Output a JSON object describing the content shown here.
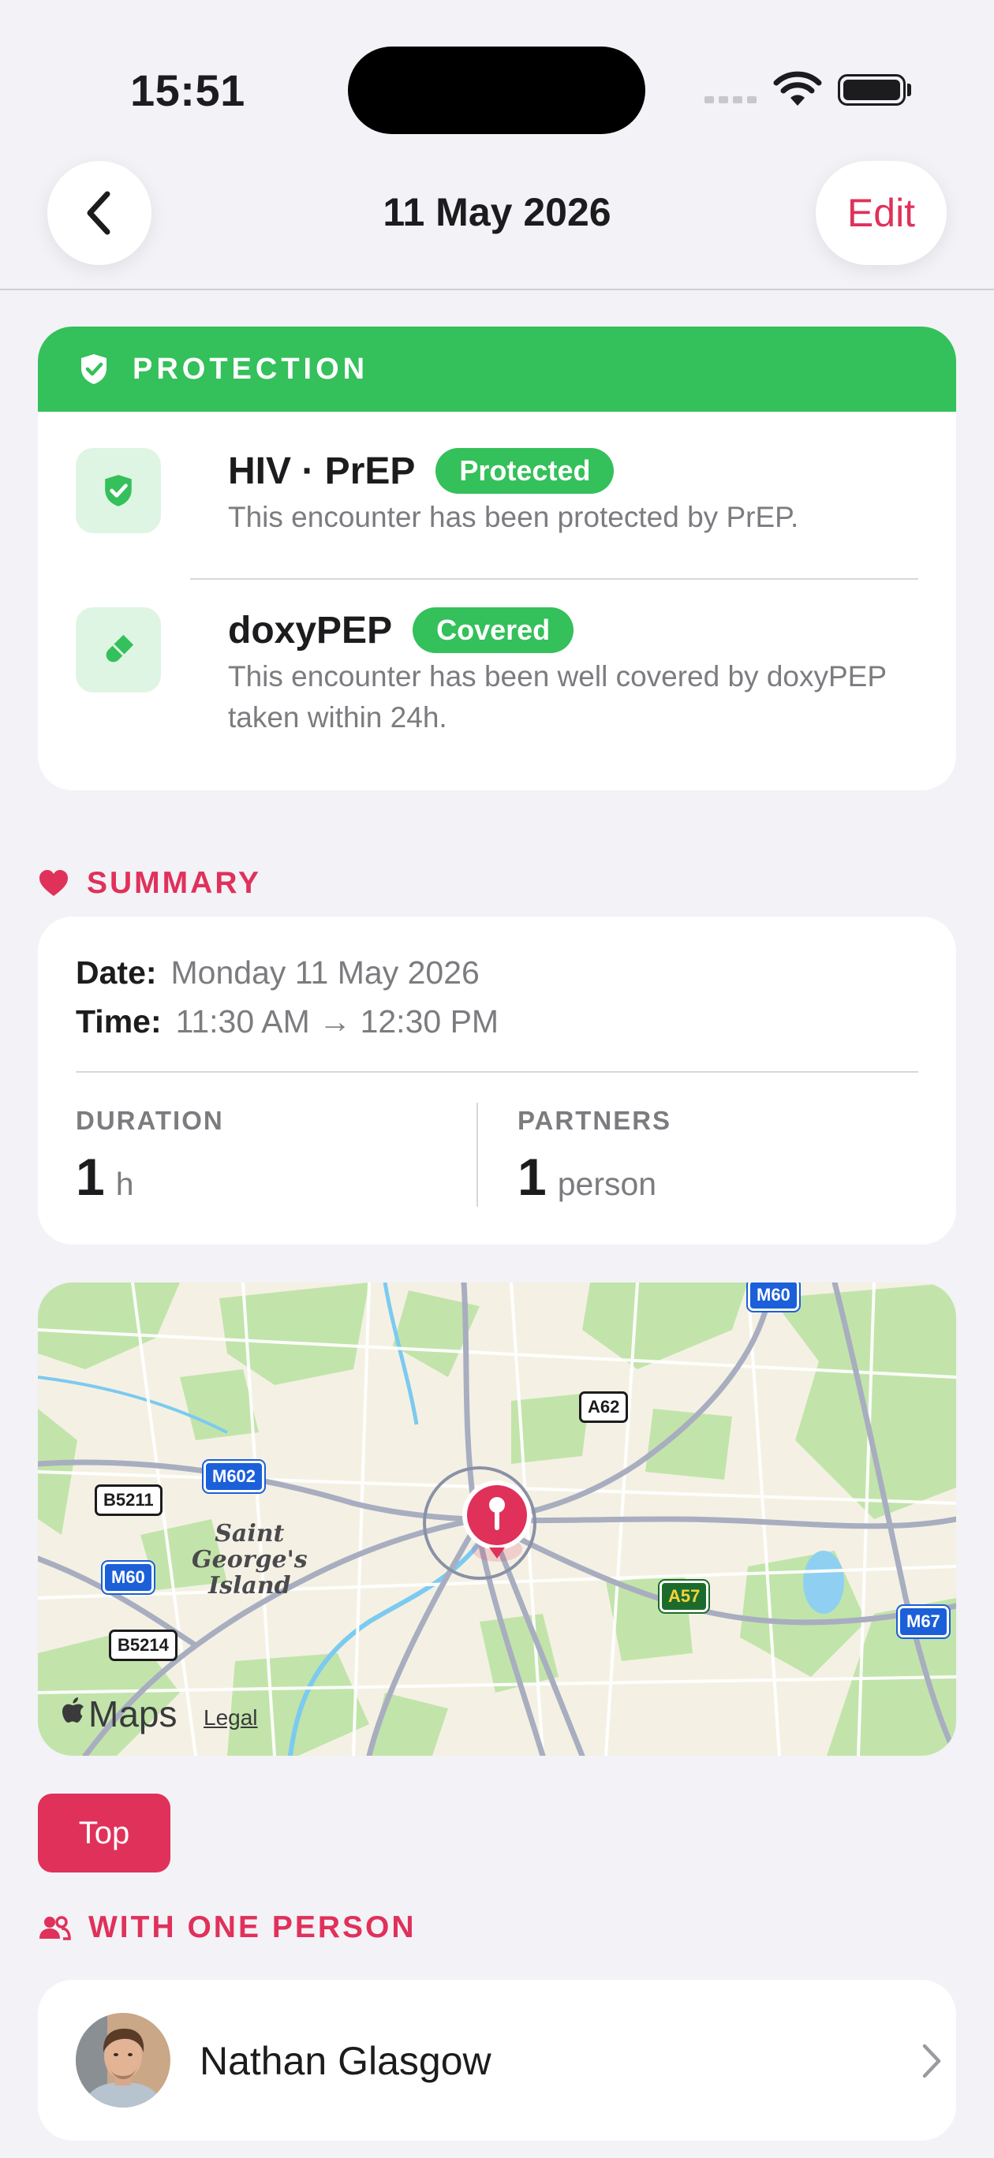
{
  "status_bar": {
    "time": "15:51"
  },
  "nav": {
    "title": "11 May 2026",
    "edit_label": "Edit"
  },
  "protection": {
    "header": "PROTECTION",
    "items": [
      {
        "title": "HIV · PrEP",
        "badge": "Protected",
        "description": "This encounter has been protected by PrEP.",
        "icon": "shield-check-icon"
      },
      {
        "title": "doxyPEP",
        "badge": "Covered",
        "description": "This encounter has been well covered by doxyPEP taken within 24h.",
        "icon": "pill-icon"
      }
    ]
  },
  "summary": {
    "header": "SUMMARY",
    "date_label": "Date:",
    "date_value": "Monday 11 May 2026",
    "time_label": "Time:",
    "time_value": "11:30 AM → 12:30 PM",
    "duration_label": "DURATION",
    "duration_value": "1",
    "duration_unit": "h",
    "partners_label": "PARTNERS",
    "partners_value": "1",
    "partners_unit": "person"
  },
  "map": {
    "place_label_lines": [
      "Saint",
      "George's",
      "Island"
    ],
    "roads": [
      "M60",
      "A62",
      "M602",
      "B5211",
      "M60",
      "B5214",
      "A57",
      "M67"
    ],
    "logo_text": "Maps",
    "legal": "Legal"
  },
  "top_button": "Top",
  "people": {
    "header": "WITH ONE PERSON",
    "items": [
      {
        "name": "Nathan Glasgow"
      }
    ]
  },
  "colors": {
    "accent": "#e0315a",
    "protection_green": "#34c05a",
    "background": "#f2f2f7"
  }
}
